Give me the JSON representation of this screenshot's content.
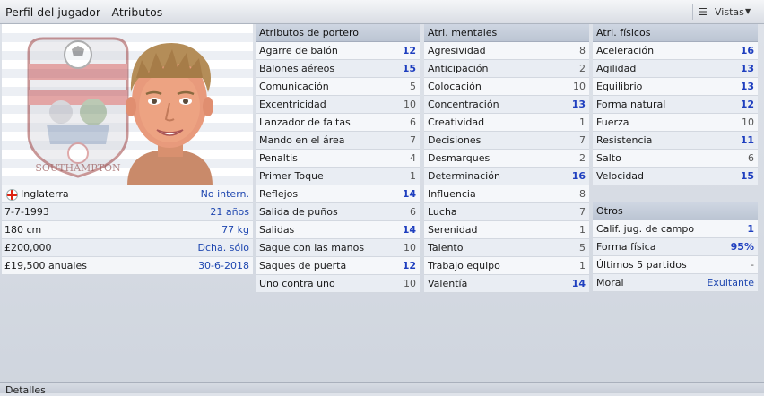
{
  "window": {
    "title": "Perfil del jugador - Atributos"
  },
  "toolbar": {
    "views_label": "Vistas"
  },
  "bio": [
    {
      "label": "Inglaterra",
      "value": "No intern.",
      "flag": true
    },
    {
      "label": "7-7-1993",
      "value": "21 años"
    },
    {
      "label": "180 cm",
      "value": "77 kg"
    },
    {
      "label": "£200,000",
      "value": "Dcha. sólo"
    },
    {
      "label": "£19,500 anuales",
      "value": "30-6-2018"
    }
  ],
  "goalkeeper": {
    "header": "Atributos de portero",
    "rows": [
      {
        "label": "Agarre de balón",
        "value": "12"
      },
      {
        "label": "Balones aéreos",
        "value": "15"
      },
      {
        "label": "Comunicación",
        "value": "5"
      },
      {
        "label": "Excentricidad",
        "value": "10"
      },
      {
        "label": "Lanzador de faltas",
        "value": "6"
      },
      {
        "label": "Mando en el área",
        "value": "7"
      },
      {
        "label": "Penaltis",
        "value": "4"
      },
      {
        "label": "Primer Toque",
        "value": "1"
      },
      {
        "label": "Reflejos",
        "value": "14"
      },
      {
        "label": "Salida de puños",
        "value": "6"
      },
      {
        "label": "Salidas",
        "value": "14"
      },
      {
        "label": "Saque con las manos",
        "value": "10"
      },
      {
        "label": "Saques de puerta",
        "value": "12"
      },
      {
        "label": "Uno contra uno",
        "value": "10"
      }
    ]
  },
  "mental": {
    "header": "Atri. mentales",
    "rows": [
      {
        "label": "Agresividad",
        "value": "8"
      },
      {
        "label": "Anticipación",
        "value": "2"
      },
      {
        "label": "Colocación",
        "value": "10"
      },
      {
        "label": "Concentración",
        "value": "13"
      },
      {
        "label": "Creatividad",
        "value": "1"
      },
      {
        "label": "Decisiones",
        "value": "7"
      },
      {
        "label": "Desmarques",
        "value": "2"
      },
      {
        "label": "Determinación",
        "value": "16"
      },
      {
        "label": "Influencia",
        "value": "8"
      },
      {
        "label": "Lucha",
        "value": "7"
      },
      {
        "label": "Serenidad",
        "value": "1"
      },
      {
        "label": "Talento",
        "value": "5"
      },
      {
        "label": "Trabajo equipo",
        "value": "1"
      },
      {
        "label": "Valentía",
        "value": "14"
      }
    ]
  },
  "physical": {
    "header": "Atri. físicos",
    "rows": [
      {
        "label": "Aceleración",
        "value": "16"
      },
      {
        "label": "Agilidad",
        "value": "13"
      },
      {
        "label": "Equilibrio",
        "value": "13"
      },
      {
        "label": "Forma natural",
        "value": "12"
      },
      {
        "label": "Fuerza",
        "value": "10"
      },
      {
        "label": "Resistencia",
        "value": "11"
      },
      {
        "label": "Salto",
        "value": "6"
      },
      {
        "label": "Velocidad",
        "value": "15"
      }
    ]
  },
  "others": {
    "header": "Otros",
    "rows": [
      {
        "label": "Calif. jug. de campo",
        "value": "1"
      },
      {
        "label": "Forma física",
        "value": "95%"
      },
      {
        "label": "Últimos 5 partidos",
        "value": "-"
      },
      {
        "label": "Moral",
        "value": "Exultante"
      }
    ]
  },
  "badge": {
    "text": "SOUTHAMPTON"
  },
  "footer": {
    "details_label": "Detalles"
  }
}
